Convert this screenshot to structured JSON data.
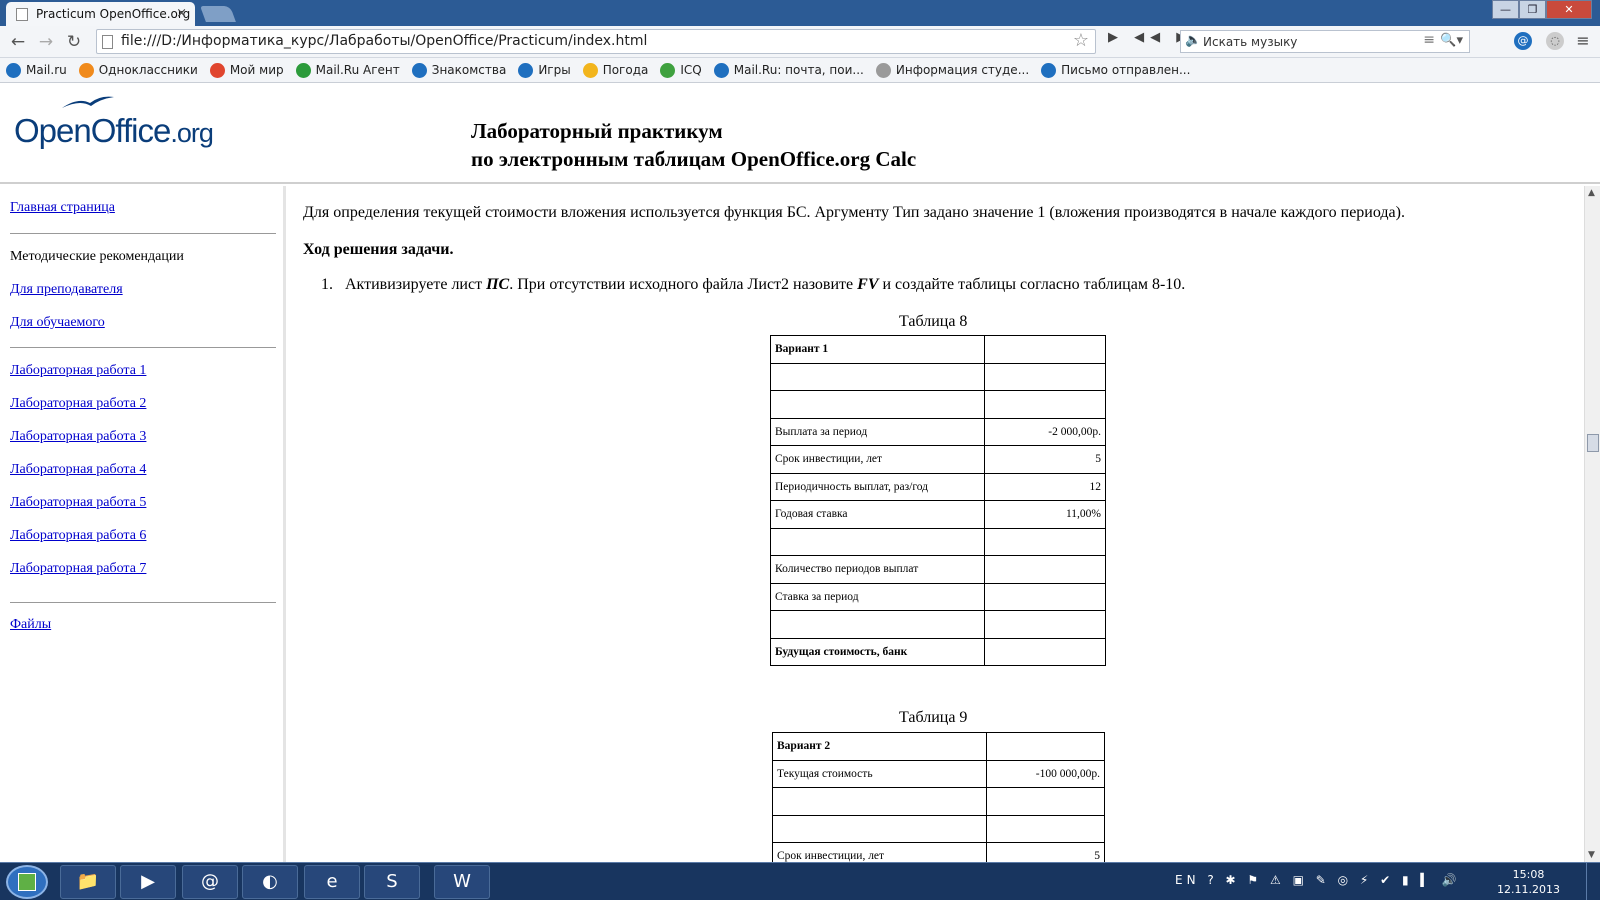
{
  "browser": {
    "tab_title": "Practicum OpenOffice.org",
    "tab_close": "×",
    "address": "file:///D:/Информатика_курс/Лабработы/OpenOffice/Practicum/index.html",
    "music_search_placeholder": "Искать музыку",
    "window_buttons": {
      "minimize": "—",
      "maximize": "❐",
      "close": "✕"
    }
  },
  "bookmarks": [
    {
      "label": "Mail.ru",
      "icon": "mail-at-icon",
      "color": "#1f6fbf"
    },
    {
      "label": "Одноклассники",
      "icon": "odnoklassniki-icon",
      "color": "#f08a1c"
    },
    {
      "label": "Мой мир",
      "icon": "moi-mir-icon",
      "color": "#e0452e"
    },
    {
      "label": "Mail.Ru Агент",
      "icon": "agent-icon",
      "color": "#2c9b3b"
    },
    {
      "label": "Знакомства",
      "icon": "dating-icon",
      "color": "#1f6fbf"
    },
    {
      "label": "Игры",
      "icon": "games-icon",
      "color": "#1f6fbf"
    },
    {
      "label": "Погода",
      "icon": "weather-icon",
      "color": "#f2b51d"
    },
    {
      "label": "ICQ",
      "icon": "icq-icon",
      "color": "#3fa13f"
    },
    {
      "label": "Mail.Ru: почта, пои...",
      "icon": "mail-at-icon",
      "color": "#1f6fbf"
    },
    {
      "label": "Информация студе...",
      "icon": "page-icon",
      "color": "#9a9a9a"
    },
    {
      "label": "Письмо отправлен...",
      "icon": "mail-at-icon",
      "color": "#1f6fbf"
    }
  ],
  "header": {
    "logo_main": "OpenOffice",
    "logo_org": ".org",
    "title_line1": "Лабораторный практикум",
    "title_line2": "по электронным таблицам OpenOffice.org Calc"
  },
  "sidebar": {
    "home": "Главная страница",
    "methodical": "Методические рекомендации",
    "for_teacher": "Для преподавателя",
    "for_student": "Для обучаемого",
    "labs": [
      "Лабораторная работа 1",
      "Лабораторная работа 2",
      "Лабораторная работа 3",
      "Лабораторная работа 4",
      "Лабораторная работа 5",
      "Лабораторная работа 6",
      "Лабораторная работа 7"
    ],
    "files": "Файлы"
  },
  "content": {
    "intro": "Для определения текущей стоимости вложения используется функция БС. Аргументу Тип задано значение 1 (вложения производятся в начале каждого периода).",
    "solution_heading": "Ход решения задачи.",
    "step1_num": "1.",
    "step1_a": "Активизируете лист ",
    "step1_ps": "ПС",
    "step1_b": ". При отсутствии исходного файла Лист2 назовите ",
    "step1_fv": "FV",
    "step1_c": " и создайте таблицы согласно таблицам 8-10.",
    "table8": {
      "caption": "Таблица 8",
      "rows": [
        {
          "label": "Вариант 1",
          "value": "",
          "bold": true
        },
        {
          "label": "",
          "value": ""
        },
        {
          "label": "",
          "value": ""
        },
        {
          "label": "Выплата за период",
          "value": "-2 000,00р."
        },
        {
          "label": "Срок инвестиции, лет",
          "value": "5"
        },
        {
          "label": "Периодичность выплат, раз/год",
          "value": "12"
        },
        {
          "label": "Годовая ставка",
          "value": "11,00%"
        },
        {
          "label": "",
          "value": ""
        },
        {
          "label": "Количество периодов выплат",
          "value": ""
        },
        {
          "label": "Ставка за период",
          "value": ""
        },
        {
          "label": "",
          "value": ""
        },
        {
          "label": "Будущая стоимость, банк",
          "value": "",
          "bold": true
        }
      ]
    },
    "table9": {
      "caption": "Таблица 9",
      "rows": [
        {
          "label": "Вариант 2",
          "value": "",
          "bold": true
        },
        {
          "label": "Текущая стоимость",
          "value": "-100 000,00р."
        },
        {
          "label": "",
          "value": ""
        },
        {
          "label": "",
          "value": ""
        },
        {
          "label": "Срок инвестиции, лет",
          "value": "5"
        }
      ]
    }
  },
  "taskbar": {
    "apps": [
      {
        "name": "explorer-icon",
        "glyph": "📁"
      },
      {
        "name": "media-player-icon",
        "glyph": "▶"
      },
      {
        "name": "mail-agent-icon",
        "glyph": "@"
      },
      {
        "name": "browser-icon",
        "glyph": "◐"
      },
      {
        "name": "internet-explorer-icon",
        "glyph": "e"
      },
      {
        "name": "skype-icon",
        "glyph": "S"
      },
      {
        "name": "word-icon",
        "glyph": "W"
      }
    ],
    "language": "EN",
    "time": "15:08",
    "date": "12.11.2013"
  }
}
